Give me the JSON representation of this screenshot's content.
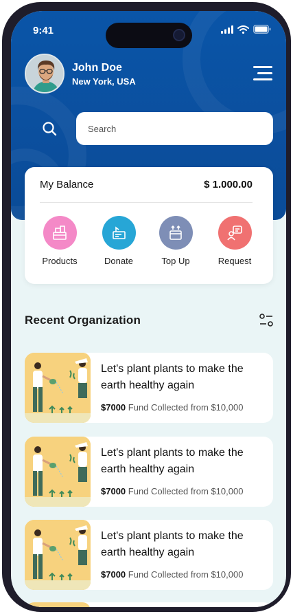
{
  "status": {
    "time": "9:41"
  },
  "user": {
    "name": "John Doe",
    "location": "New York, USA"
  },
  "search": {
    "placeholder": "Search"
  },
  "balance": {
    "label": "My Balance",
    "value": "$ 1.000.00"
  },
  "actions": [
    {
      "label": "Products",
      "color": "#f489c7"
    },
    {
      "label": "Donate",
      "color": "#27a6d6"
    },
    {
      "label": "Top Up",
      "color": "#7e8eb6"
    },
    {
      "label": "Request",
      "color": "#f07171"
    }
  ],
  "section": {
    "title": "Recent Organization"
  },
  "organizations": [
    {
      "title": "Let's plant plants to make the earth healthy again",
      "amount": "$7000",
      "fund_text": "Fund Collected from $10,000"
    },
    {
      "title": "Let's plant plants to make the earth healthy again",
      "amount": "$7000",
      "fund_text": "Fund Collected from $10,000"
    },
    {
      "title": "Let's plant plants to make the earth healthy again",
      "amount": "$7000",
      "fund_text": "Fund Collected from $10,000"
    }
  ],
  "colors": {
    "header": "#0b4f9e",
    "background": "#eaf5f6",
    "accent": "#ffffff"
  },
  "icons": [
    "signal-icon",
    "wifi-icon",
    "battery-icon",
    "menu-icon",
    "search-icon",
    "filter-icon"
  ]
}
